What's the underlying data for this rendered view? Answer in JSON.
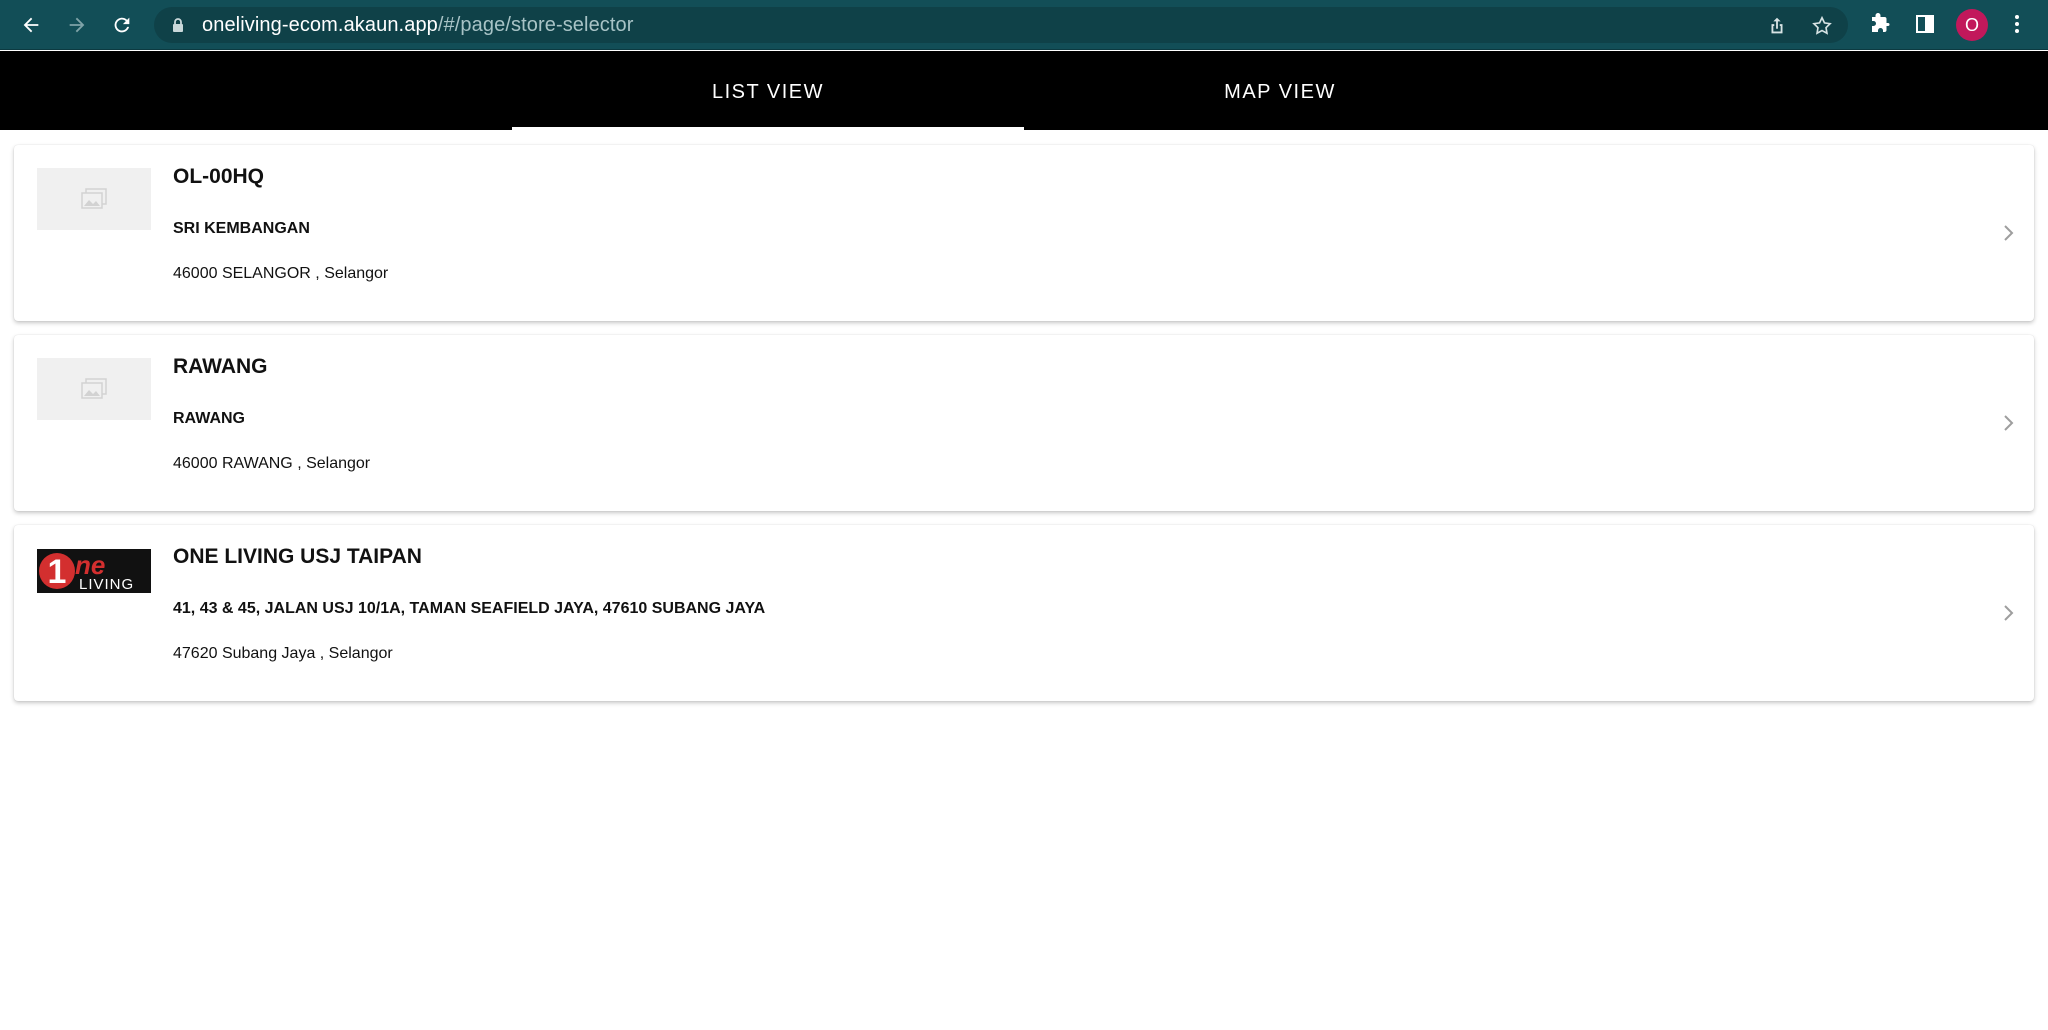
{
  "browser": {
    "url_host": "oneliving-ecom.akaun.app",
    "url_path": "/#/page/store-selector",
    "avatar_letter": "O"
  },
  "tabs": [
    {
      "label": "LIST VIEW",
      "active": true
    },
    {
      "label": "MAP VIEW",
      "active": false
    }
  ],
  "stores": [
    {
      "name": "OL-00HQ",
      "street": "SRI KEMBANGAN",
      "city": "46000 SELANGOR , Selangor",
      "image": "placeholder-image-icon"
    },
    {
      "name": "RAWANG",
      "street": "RAWANG",
      "city": "46000 RAWANG , Selangor",
      "image": "placeholder-image-icon"
    },
    {
      "name": "ONE LIVING USJ TAIPAN",
      "street": "41, 43 & 45, JALAN USJ 10/1A, TAMAN SEAFIELD JAYA, 47610 SUBANG JAYA",
      "city": "47620 Subang Jaya , Selangor",
      "image": "one-living-logo",
      "logo_text": {
        "numeral": "1",
        "ne": "ne",
        "living": "LIVING"
      }
    }
  ],
  "colors": {
    "chrome": "#124e57",
    "tabbar": "#000000",
    "logo_red": "#d32f2f"
  }
}
